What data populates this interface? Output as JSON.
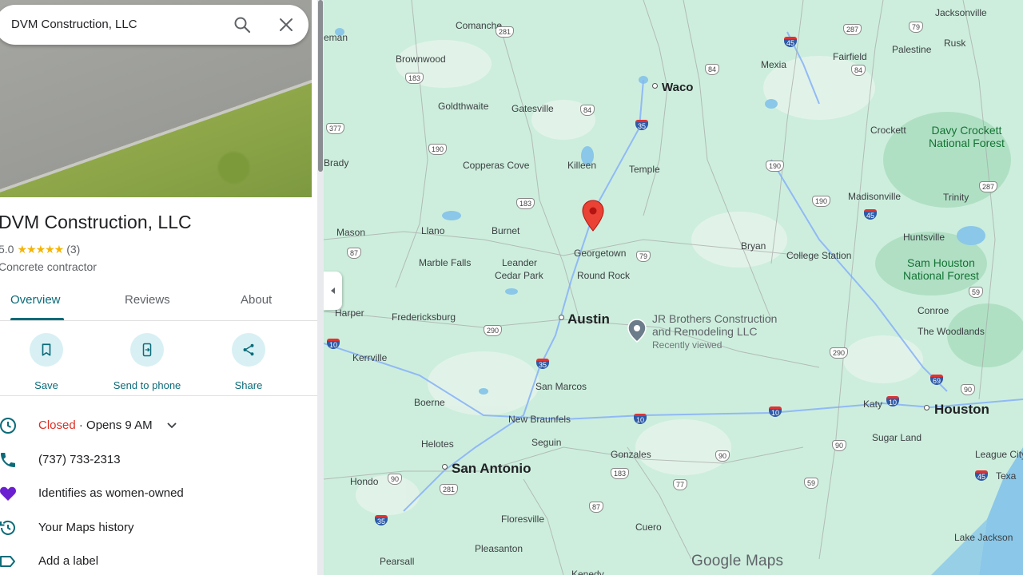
{
  "search": {
    "query": "DVM Construction, LLC"
  },
  "place": {
    "name": "DVM Construction, LLC",
    "rating": "5.0",
    "stars": "★★★★★",
    "review_count": "(3)",
    "category": "Concrete contractor"
  },
  "tabs": [
    "Overview",
    "Reviews",
    "About"
  ],
  "actions": [
    {
      "label": "Save",
      "icon": "bookmark-icon"
    },
    {
      "label": "Send to phone",
      "icon": "send-to-phone-icon"
    },
    {
      "label": "Share",
      "icon": "share-icon"
    }
  ],
  "info": {
    "hours_status": "Closed",
    "hours_next": " · Opens 9 AM",
    "phone": "(737) 733-2313",
    "women_owned": "Identifies as women-owned",
    "history": "Your Maps history",
    "add_label": "Add a label"
  },
  "map": {
    "cities_big": [
      "Austin",
      "San Antonio",
      "Houston",
      "Waco"
    ],
    "towns": [
      "Comanche",
      "Brownwood",
      "Goldthwaite",
      "Gatesville",
      "Copperas Cove",
      "Killeen",
      "Temple",
      "Mexia",
      "Fairfield",
      "Palestine",
      "Rusk",
      "Jacksonville",
      "Crockett",
      "Madisonville",
      "Trinity",
      "Huntsville",
      "Bryan",
      "College Station",
      "Georgetown",
      "Round Rock",
      "Burnet",
      "Llano",
      "Mason",
      "Marble Falls",
      "Leander",
      "Cedar Park",
      "Harper",
      "Fredericksburg",
      "Kerrville",
      "Boerne",
      "New Braunfels",
      "San Marcos",
      "Seguin",
      "Gonzales",
      "Helotes",
      "Hondo",
      "Floresville",
      "Pleasanton",
      "Pearsall",
      "Cuero",
      "Katy",
      "Sugar Land",
      "Conroe",
      "The Woodlands",
      "League City",
      "Lake Jackson",
      "Brady",
      "Texa",
      "Kenedy",
      "eman"
    ],
    "parks": [
      "Davy Crockett\nNational Forest",
      "Sam Houston\nNational Forest"
    ],
    "poi_name": "JR Brothers Construction\nand Remodeling LLC",
    "poi_sub": "Recently viewed",
    "watermark": "Google Maps",
    "highways": [
      "281",
      "183",
      "377",
      "190",
      "84",
      "35",
      "287",
      "79",
      "84",
      "45",
      "84",
      "190",
      "183",
      "87",
      "79",
      "190",
      "45",
      "287",
      "290",
      "10",
      "35",
      "290",
      "10",
      "10",
      "90",
      "69",
      "90",
      "59",
      "90",
      "90",
      "281",
      "87",
      "77",
      "183",
      "59",
      "45",
      "35",
      "10"
    ],
    "colors": {
      "land": "#cdeedd",
      "water": "#8ac7e8",
      "pin": "#ea4335",
      "accent": "#0b6b79"
    }
  }
}
